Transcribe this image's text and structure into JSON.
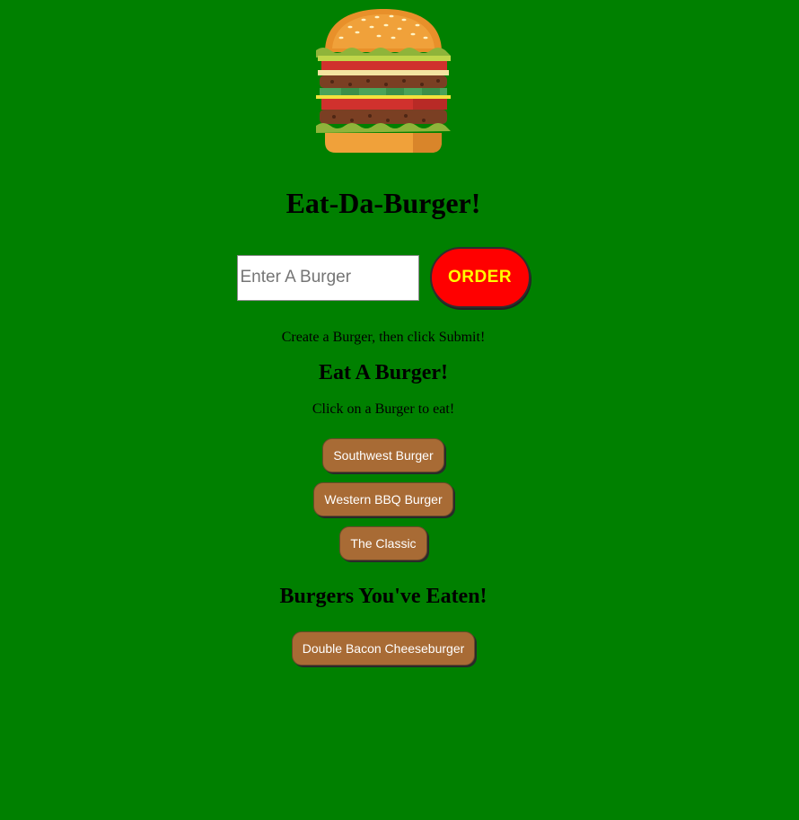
{
  "header": {
    "logo_icon": "burger-icon",
    "title": "Eat-Da-Burger!"
  },
  "order_form": {
    "input_placeholder": "Enter A Burger",
    "input_value": "",
    "order_label": "ORDER",
    "hint": "Create a Burger, then click Submit!"
  },
  "eat_section": {
    "heading": "Eat A Burger!",
    "hint": "Click on a Burger to eat!",
    "burgers": [
      {
        "name": "Southwest Burger"
      },
      {
        "name": "Western BBQ Burger"
      },
      {
        "name": "The Classic"
      }
    ]
  },
  "eaten_section": {
    "heading": "Burgers You've Eaten!",
    "burgers": [
      {
        "name": "Double Bacon Cheeseburger"
      }
    ]
  },
  "colors": {
    "background": "#008000",
    "order_button": "#ff0000",
    "order_text": "#ffff00",
    "burger_button": "#a86b35"
  }
}
